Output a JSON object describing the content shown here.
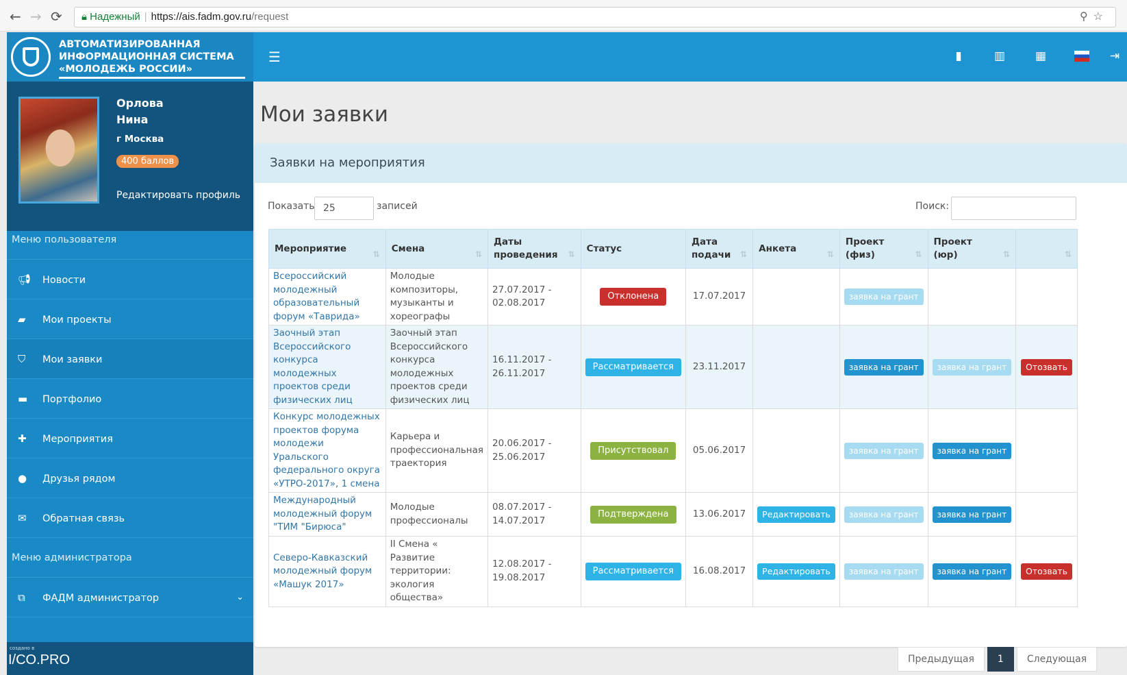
{
  "browser": {
    "secure_label": "Надежный",
    "url_host": "https://ais.fadm.gov.ru",
    "url_path": "/request"
  },
  "brand": {
    "line1": "Автоматизированная",
    "line2": "информационная система",
    "line3": "«Молодежь России»"
  },
  "profile": {
    "last_name": "Орлова",
    "first_name": "Нина",
    "city": "г Москва",
    "points": "400 баллов",
    "edit_label": "Редактировать профиль"
  },
  "sidebar": {
    "user_menu_header": "Меню пользователя",
    "items": [
      {
        "label": "Новости",
        "icon": "bullhorn-icon"
      },
      {
        "label": "Мои проекты",
        "icon": "book-icon"
      },
      {
        "label": "Мои заявки",
        "icon": "bookmark-icon"
      },
      {
        "label": "Портфолио",
        "icon": "folder-icon"
      },
      {
        "label": "Мероприятия",
        "icon": "puzzle-icon"
      },
      {
        "label": "Друзья рядом",
        "icon": "map-marker-icon"
      },
      {
        "label": "Обратная связь",
        "icon": "envelope-icon"
      }
    ],
    "admin_menu_header": "Меню администратора",
    "admin_item": "ФАДМ администратор",
    "credit_small": "создано в",
    "credit": "I/CO.PRO"
  },
  "page": {
    "title": "Мои заявки",
    "panel_title": "Заявки на мероприятия",
    "show_label": "Показать",
    "show_value": "25",
    "records_label": "записей",
    "search_label": "Поиск:"
  },
  "table": {
    "headers": {
      "event": "Мероприятие",
      "shift": "Смена",
      "dates": "Даты проведения",
      "status": "Статус",
      "submitted": "Дата подачи",
      "form": "Анкета",
      "proj_phys": "Проект (физ)",
      "proj_legal": "Проект (юр)"
    },
    "rows": [
      {
        "event": "Всероссийский молодежный образовательный форум «Таврида»",
        "shift": "Молодые композиторы, музыканты и хореографы",
        "dates": "27.07.2017 - 02.08.2017",
        "status": "Отклонена",
        "submitted": "17.07.2017",
        "form": "",
        "phys": "заявка на грант",
        "legal": "",
        "recall": ""
      },
      {
        "event": "Заочный этап Всероссийского конкурса молодежных проектов среди физических лиц",
        "shift": "Заочный этап Всероссийского конкурса молодежных проектов среди физических лиц",
        "dates": "16.11.2017 - 26.11.2017",
        "status": "Рассматривается",
        "submitted": "23.11.2017",
        "form": "",
        "phys": "заявка на грант",
        "legal": "заявка на грант",
        "recall": "Отозвать"
      },
      {
        "event": "Конкурс молодежных проектов форума молодежи Уральского федерального округа «УТРО-2017», 1 смена",
        "shift": "Карьера и профессиональная траектория",
        "dates": "20.06.2017 - 25.06.2017",
        "status": "Присутствовал",
        "submitted": "05.06.2017",
        "form": "",
        "phys": "заявка на грант",
        "legal": "заявка на грант",
        "recall": ""
      },
      {
        "event": "Международный молодежный форум \"ТИМ \"Бирюса\"",
        "shift": "Молодые профессионалы",
        "dates": "08.07.2017 - 14.07.2017",
        "status": "Подтверждена",
        "submitted": "13.06.2017",
        "form": "Редактировать",
        "phys": "заявка на грант",
        "legal": "заявка на грант",
        "recall": ""
      },
      {
        "event": "Северо-Кавказский молодежный форум «Машук 2017»",
        "shift": "II Смена « Развитие территории: экология общества»",
        "dates": "12.08.2017 - 19.08.2017",
        "status": "Рассматривается",
        "submitted": "16.08.2017",
        "form": "Редактировать",
        "phys": "заявка на грант",
        "legal": "заявка на грант",
        "recall": "Отозвать"
      }
    ]
  },
  "pager": {
    "prev": "Предыдущая",
    "current": "1",
    "next": "Следующая"
  },
  "colors": {
    "topbar": "#1f94d2",
    "sidebar": "#1a8ac6",
    "profile_bg": "#12547d",
    "status_rejected": "#c9302c",
    "status_review": "#2fb3e6",
    "status_ok": "#8cb341"
  }
}
